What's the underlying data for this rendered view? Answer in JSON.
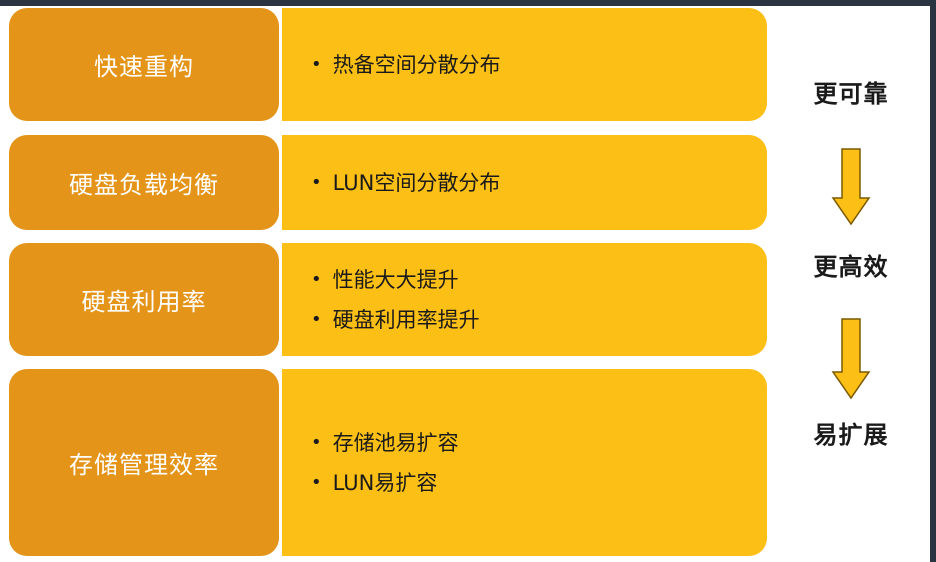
{
  "rows": [
    {
      "label": "快速重构",
      "bullets": [
        "热备空间分散分布"
      ]
    },
    {
      "label": "硬盘负载均衡",
      "bullets": [
        "LUN空间分散分布"
      ]
    },
    {
      "label": "硬盘利用率",
      "bullets": [
        "性能大大提升",
        "硬盘利用率提升"
      ]
    },
    {
      "label": "存储管理效率",
      "bullets": [
        "存储池易扩容",
        "LUN易扩容"
      ]
    }
  ],
  "benefits": [
    "更可靠",
    "更高效",
    "易扩展"
  ],
  "bullet_symbol": "•",
  "colors": {
    "label_box": "#e49418",
    "detail_box": "#fcbf16",
    "arrow_fill": "#fcbf16",
    "arrow_stroke": "#7a5a00"
  },
  "icons": {
    "flow_arrow": "down-arrow-icon"
  }
}
